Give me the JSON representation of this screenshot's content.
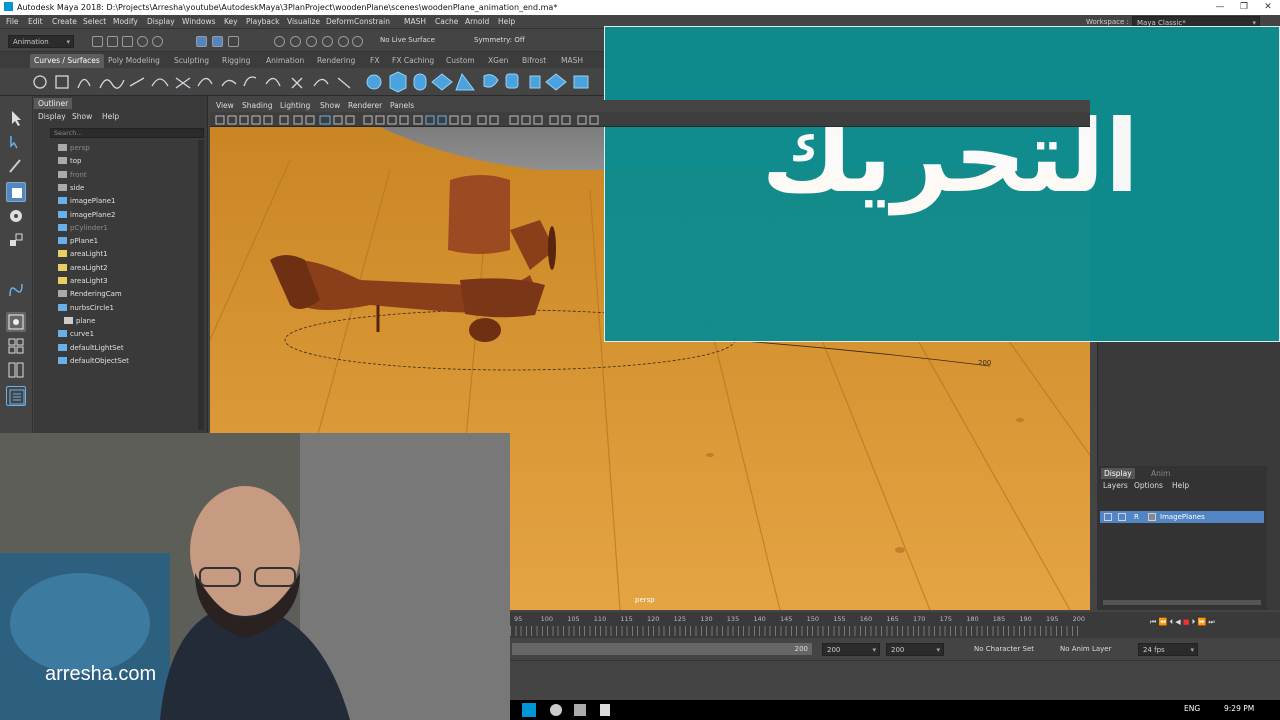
{
  "window": {
    "title": "Autodesk Maya 2018: D:\\Projects\\Arresha\\youtube\\AutodeskMaya\\3PlanProject\\woodenPlane\\scenes\\woodenPlane_animation_end.ma*"
  },
  "menubar": [
    "File",
    "Edit",
    "Create",
    "Select",
    "Modify",
    "Display",
    "Windows",
    "Key",
    "Playback",
    "Visualize",
    "Deform",
    "Constrain",
    "MASH",
    "Cache",
    "Arnold",
    "Help"
  ],
  "workspace": {
    "label": "Workspace :",
    "value": "Maya Classic*"
  },
  "statusline": {
    "mode": "Animation",
    "live_surface": "No Live Surface",
    "symmetry": "Symmetry: Off"
  },
  "shelf_tabs": [
    "Curves / Surfaces",
    "Poly Modeling",
    "Sculpting",
    "Rigging",
    "Animation",
    "Rendering",
    "FX",
    "FX Caching",
    "Custom",
    "XGen",
    "Bifrost",
    "MASH"
  ],
  "outliner": {
    "title": "Outliner",
    "menu": [
      "Display",
      "Show",
      "Help"
    ],
    "search_placeholder": "Search...",
    "items": [
      {
        "label": "persp",
        "dim": true
      },
      {
        "label": "top",
        "dim": false
      },
      {
        "label": "front",
        "dim": true
      },
      {
        "label": "side",
        "dim": false
      },
      {
        "label": "imagePlane1",
        "dim": false
      },
      {
        "label": "imagePlane2",
        "dim": false
      },
      {
        "label": "pCylinder1",
        "dim": true
      },
      {
        "label": "pPlane1",
        "dim": false
      },
      {
        "label": "areaLight1",
        "dim": false
      },
      {
        "label": "areaLight2",
        "dim": false
      },
      {
        "label": "areaLight3",
        "dim": false
      },
      {
        "label": "RenderingCam",
        "dim": false
      },
      {
        "label": "nurbsCircle1",
        "dim": false
      },
      {
        "label": "plane",
        "dim": false
      },
      {
        "label": "curve1",
        "dim": false
      },
      {
        "label": "defaultLightSet",
        "dim": false
      },
      {
        "label": "defaultObjectSet",
        "dim": false
      }
    ]
  },
  "viewport": {
    "menu": [
      "View",
      "Shading",
      "Lighting",
      "Show",
      "Renderer",
      "Panels"
    ],
    "camera_label": "persp",
    "path_label": "200"
  },
  "layers": {
    "tabs": [
      "Display",
      "Anim"
    ],
    "menu": [
      "Layers",
      "Options",
      "Help"
    ],
    "layer_name": "ImagePlanes",
    "layer_flag": "R"
  },
  "timeline": {
    "ticks": [
      "95",
      "100",
      "105",
      "110",
      "115",
      "120",
      "125",
      "130",
      "135",
      "140",
      "145",
      "150",
      "155",
      "160",
      "165",
      "170",
      "175",
      "180",
      "185",
      "190",
      "195",
      "200"
    ],
    "end_field": "200",
    "range_start": "200",
    "range_end": "200",
    "character_set": "No Character Set",
    "anim_layer": "No Anim Layer",
    "fps": "24 fps"
  },
  "taskbar": {
    "lang": "ENG",
    "time": "9:29 PM"
  },
  "overlay": {
    "title": "التحريك"
  },
  "webcam": {
    "site": "arresha.com"
  },
  "colors": {
    "banner": "#0c8c8f",
    "maya_bg": "#444444",
    "wood": "#d18f2b",
    "selected_layer": "#5285c4"
  }
}
